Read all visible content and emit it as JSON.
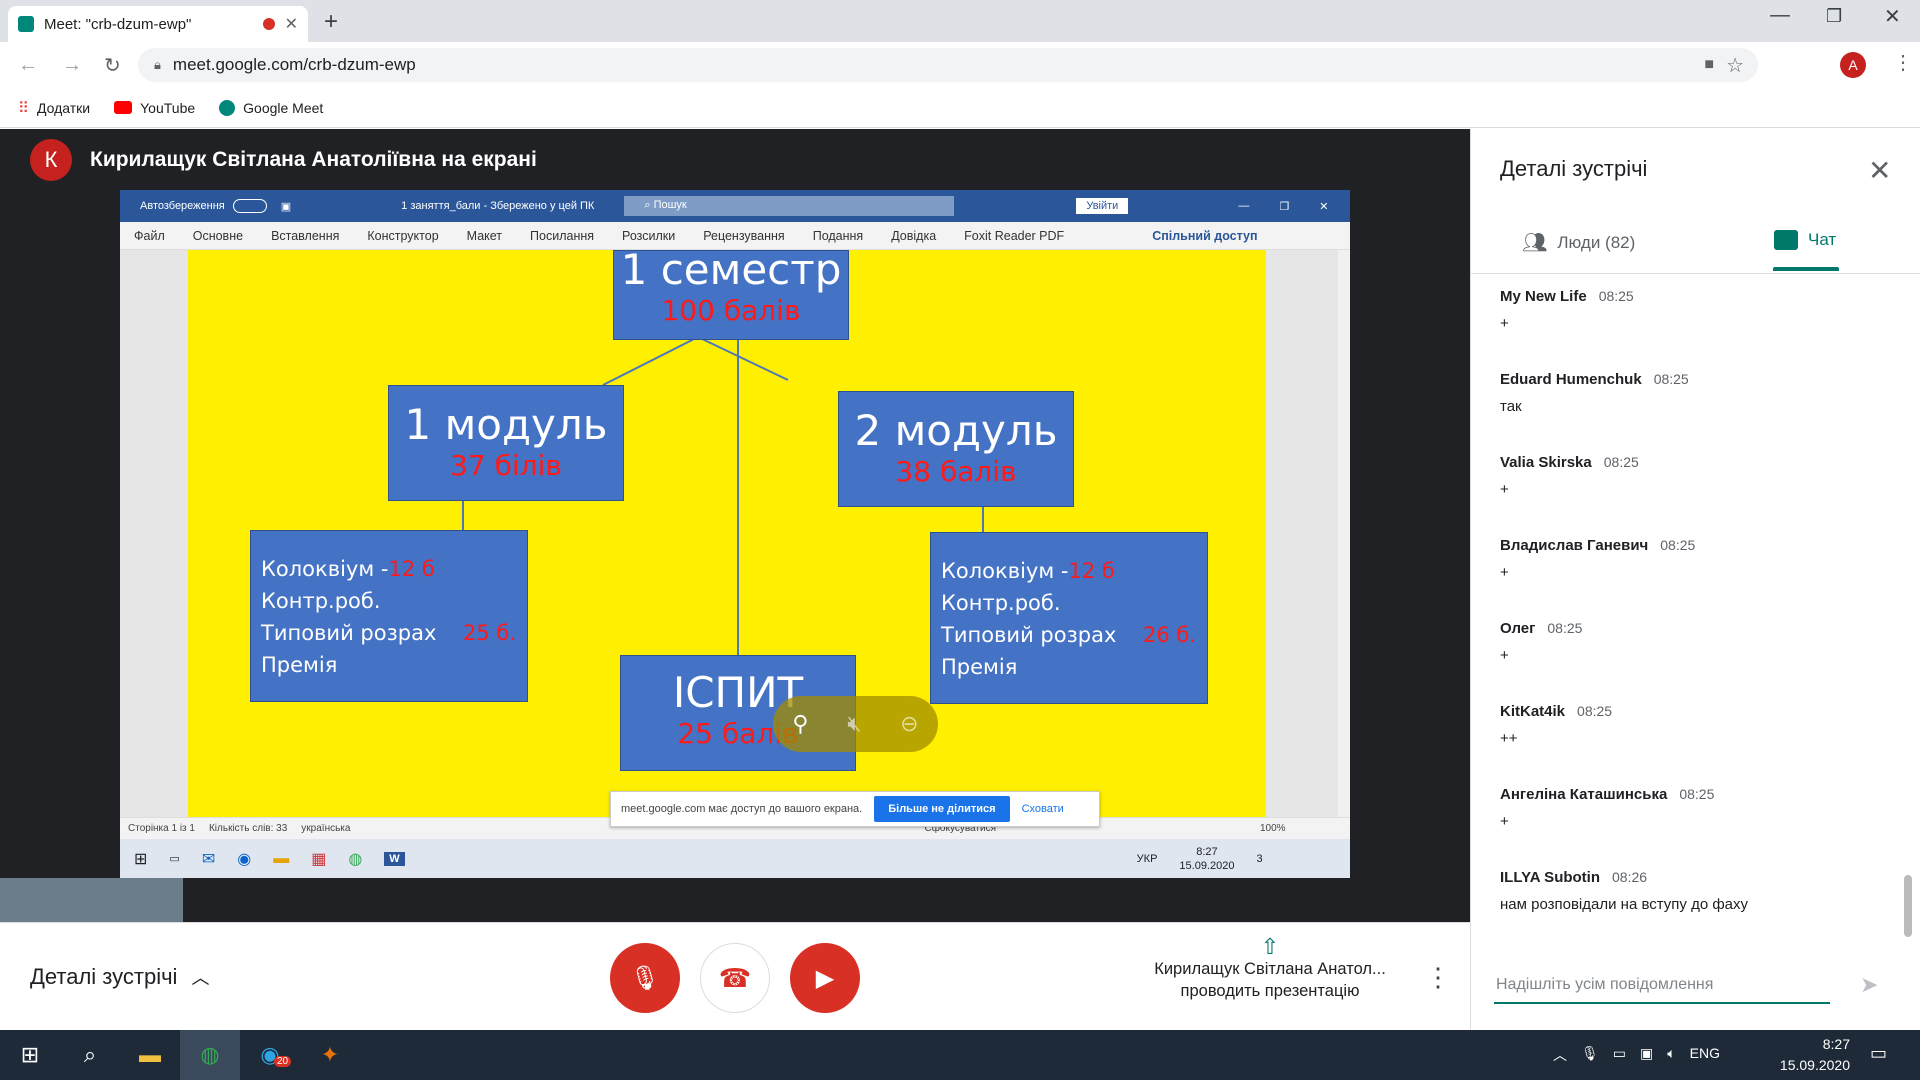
{
  "browser": {
    "tab_title": "Meet: \"crb-dzum-ewp\"",
    "url": "meet.google.com/crb-dzum-ewp",
    "avatar_letter": "A",
    "bookmarks": [
      "Додатки",
      "YouTube",
      "Google Meet"
    ]
  },
  "meet": {
    "presenter_initial": "К",
    "presenter_banner": "Кирилащук Світлана Анатоліївна на екрані",
    "details_label": "Деталі зустрічі",
    "presenting_name": "Кирилащук Світлана Анатол...",
    "presenting_status": "проводить презентацію"
  },
  "word": {
    "autosave": "Автозбереження",
    "doc_title": "1 заняття_бали  -  Збережено у цей ПК",
    "search": "Пошук",
    "signin": "Увійти",
    "ribbon": [
      "Файл",
      "Основне",
      "Вставлення",
      "Конструктор",
      "Макет",
      "Посилання",
      "Розсилки",
      "Рецензування",
      "Подання",
      "Довідка",
      "Foxit Reader PDF"
    ],
    "share": "Спільний доступ",
    "status": [
      "Сторінка 1 із 1",
      "Кількість слів: 33",
      "українська"
    ],
    "focus": "Сфокусуватися",
    "zoom": "100%"
  },
  "diagram": {
    "top_title": "1 семестр",
    "top_points": "100 балів",
    "m1_title": "1 модуль",
    "m1_points": "37 білів",
    "m2_title": "2 модуль",
    "m2_points": "38 балів",
    "exam_title": "ІСПИТ",
    "exam_points": "25 балів",
    "left_items": [
      "Колоквіум -",
      "Контр.роб.",
      "Типовий розрах",
      "Премія"
    ],
    "left_colloq": "12 б",
    "left_sum": "25 б.",
    "right_items": [
      "Колоквіум -",
      "Контр.роб.",
      "Типовий розрах",
      "Премія"
    ],
    "right_colloq": "12 б",
    "right_sum": "26 б."
  },
  "share_notice": {
    "text": "meet.google.com має доступ до вашого екрана.",
    "stop": "Більше не ділитися",
    "hide": "Сховати"
  },
  "inner_taskbar": {
    "lang": "УКР",
    "time": "8:27",
    "date": "15.09.2020",
    "badge": "3"
  },
  "panel": {
    "title": "Деталі зустрічі",
    "people_tab": "Люди (82)",
    "chat_tab": "Чат",
    "messages": [
      {
        "name": "My New Life",
        "time": "08:25",
        "text": "+"
      },
      {
        "name": "Eduard Humenchuk",
        "time": "08:25",
        "text": "так"
      },
      {
        "name": "Valia Skirska",
        "time": "08:25",
        "text": "+"
      },
      {
        "name": "Владислав Ганевич",
        "time": "08:25",
        "text": "+"
      },
      {
        "name": "Олег",
        "time": "08:25",
        "text": "+"
      },
      {
        "name": "KitKat4ik",
        "time": "08:25",
        "text": "++"
      },
      {
        "name": "Ангеліна Каташинська",
        "time": "08:25",
        "text": "+"
      },
      {
        "name": "ILLYA Subotin",
        "time": "08:26",
        "text": "нам розповідали на вступу до фаху"
      }
    ],
    "input_placeholder": "Надішліть усім повідомлення"
  },
  "taskbar": {
    "lang": "ENG",
    "time": "8:27",
    "date": "15.09.2020",
    "telegram_badge": "20"
  },
  "colors": {
    "meet_red": "#d93025",
    "accent": "#00796b",
    "diagram_blue": "#4472c4",
    "diagram_yellow": "#ffef00"
  }
}
